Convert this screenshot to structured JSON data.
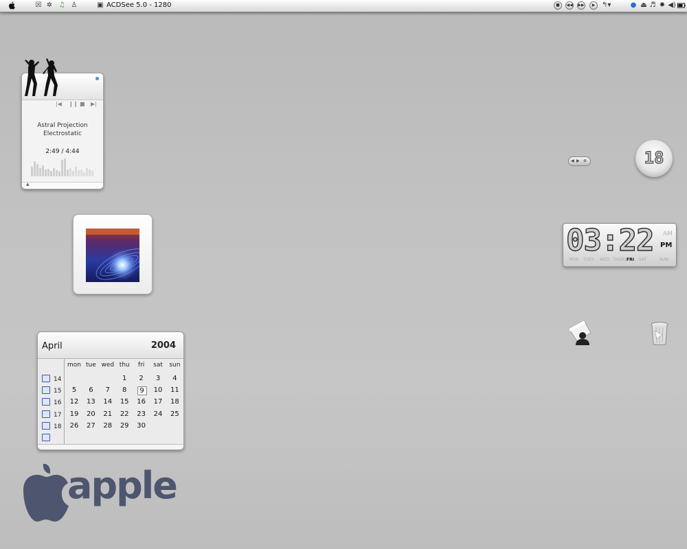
{
  "menubar": {
    "app_title": "ACDSee 5.0 - 1280",
    "left_icons": [
      "apple-menu-icon",
      "app-icon-1",
      "app-icon-2",
      "itunes-icon",
      "app-icon-4",
      "acdsee-icon"
    ],
    "right_icons": [
      "stop-icon",
      "rewind-icon",
      "fast-forward-icon",
      "play-icon",
      "repeat-icon",
      "internet-icon",
      "eject-icon",
      "music-note-icon",
      "gear-icon",
      "volume-icon",
      "battery-icon"
    ]
  },
  "player": {
    "artist": "Astral Projection",
    "track": "Electrostatic",
    "time": "2:49  /  4:44",
    "level_fraction": 0.62
  },
  "calendar": {
    "month": "April",
    "year": "2004",
    "weekdays": [
      "mon",
      "tue",
      "wed",
      "thu",
      "fri",
      "sat",
      "sun"
    ],
    "weeks": [
      {
        "num": "14",
        "days": [
          "",
          "",
          "",
          "1",
          "2",
          "3",
          "4"
        ]
      },
      {
        "num": "15",
        "days": [
          "5",
          "6",
          "7",
          "8",
          "9",
          "10",
          "11"
        ]
      },
      {
        "num": "16",
        "days": [
          "12",
          "13",
          "14",
          "15",
          "16",
          "17",
          "18"
        ]
      },
      {
        "num": "17",
        "days": [
          "19",
          "20",
          "21",
          "22",
          "23",
          "24",
          "25"
        ]
      },
      {
        "num": "18",
        "days": [
          "26",
          "27",
          "28",
          "29",
          "30",
          "",
          ""
        ]
      },
      {
        "num": "",
        "days": [
          "",
          "",
          "",
          "",
          "",
          "",
          ""
        ]
      }
    ],
    "today": "9"
  },
  "logo": {
    "word": "apple",
    "color": "#4d566e"
  },
  "round_clock": {
    "value": "18"
  },
  "digital_clock": {
    "time": "03:22",
    "am": "AM",
    "pm": "PM",
    "days": [
      "MON",
      "TUES",
      "WED",
      "THURS",
      "FRI",
      "SAT",
      "SUN"
    ],
    "current_day": "FRI"
  },
  "desktop_icons": [
    "user-folder-icon",
    "trash-icon"
  ]
}
